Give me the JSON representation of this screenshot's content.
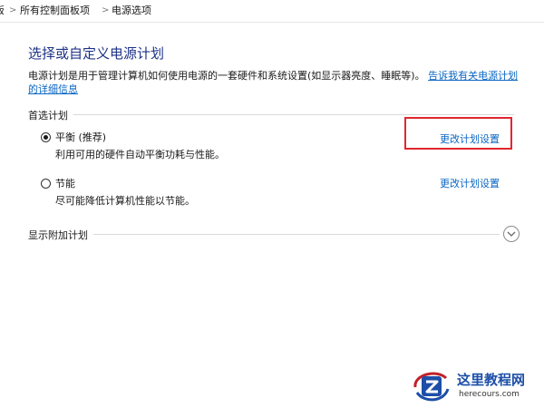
{
  "breadcrumb": {
    "items": [
      "所有控制面板项",
      "电源选项"
    ],
    "separator": ">",
    "truncated_prefix": "板"
  },
  "page": {
    "title": "选择或自定义电源计划",
    "description_text": "电源计划是用于管理计算机如何使用电源的一套硬件和系统设置(如显示器亮度、睡眠等)。",
    "description_link": "告诉我有关电源计划的详细信息"
  },
  "preferred_plans": {
    "header": "首选计划",
    "plans": [
      {
        "name": "平衡 (推荐)",
        "description": "利用可用的硬件自动平衡功耗与性能。",
        "selected": true,
        "change_link": "更改计划设置",
        "highlighted": true
      },
      {
        "name": "节能",
        "description": "尽可能降低计算机性能以节能。",
        "selected": false,
        "change_link": "更改计划设置",
        "highlighted": false
      }
    ]
  },
  "additional_plans": {
    "header": "显示附加计划",
    "expand_icon": "chevron-down-icon"
  },
  "watermark": {
    "title": "这里教程网",
    "url": "herecours.com"
  },
  "colors": {
    "title_blue": "#1e3287",
    "link_blue": "#0a66c2",
    "highlight_red": "#e0262f"
  }
}
